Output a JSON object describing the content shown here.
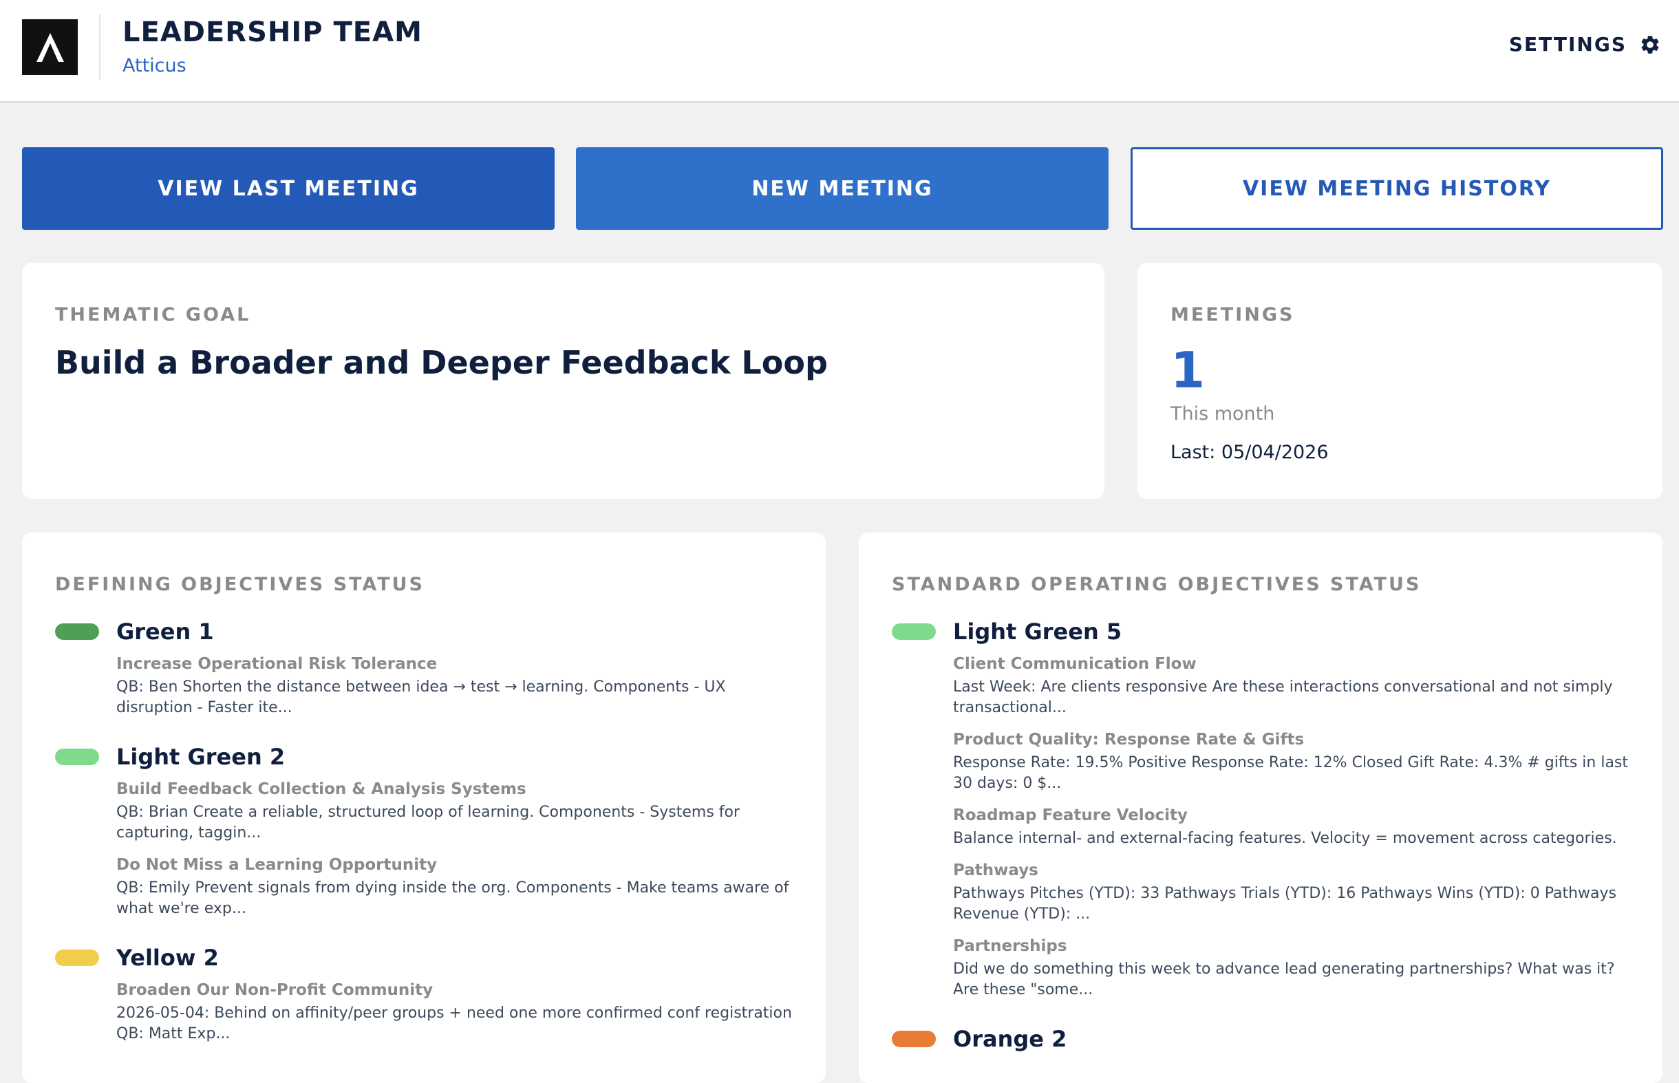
{
  "header": {
    "team_title": "LEADERSHIP TEAM",
    "team_subtitle": "Atticus",
    "settings_label": "SETTINGS",
    "logo_icon": "atticus-logo-icon",
    "settings_icon": "gear-icon"
  },
  "actions": {
    "view_last": "VIEW LAST MEETING",
    "new_meeting": "NEW MEETING",
    "view_history": "VIEW MEETING HISTORY"
  },
  "thematic_goal": {
    "label": "THEMATIC GOAL",
    "text": "Build a Broader and Deeper Feedback Loop"
  },
  "meetings": {
    "label": "MEETINGS",
    "count": "1",
    "period": "This month",
    "last": "Last: 05/04/2026"
  },
  "colors": {
    "green": "#4f9f55",
    "light_green": "#7ddb8b",
    "yellow": "#f2cd4a",
    "orange": "#e87c35",
    "primary": "#2359b7",
    "accent": "#2f70cb"
  },
  "defining": {
    "label": "DEFINING OBJECTIVES STATUS",
    "groups": [
      {
        "title": "Green 1",
        "color": "#4f9f55",
        "items": [
          {
            "title": "Increase Operational Risk Tolerance",
            "desc": "QB: Ben Shorten the distance between idea → test → learning. Components - UX disruption - Faster ite..."
          }
        ]
      },
      {
        "title": "Light Green 2",
        "color": "#7ddb8b",
        "items": [
          {
            "title": "Build Feedback Collection & Analysis Systems",
            "desc": "QB: Brian Create a reliable, structured loop of learning. Components - Systems for capturing, taggin..."
          },
          {
            "title": "Do Not Miss a Learning Opportunity",
            "desc": "QB: Emily Prevent signals from dying inside the org. Components - Make teams aware of what we're exp..."
          }
        ]
      },
      {
        "title": "Yellow 2",
        "color": "#f2cd4a",
        "items": [
          {
            "title": "Broaden Our Non-Profit Community",
            "desc": "2026-05-04: Behind on affinity/peer groups + need one more confirmed conf registration QB: Matt Exp..."
          }
        ]
      }
    ]
  },
  "standard": {
    "label": "STANDARD OPERATING OBJECTIVES STATUS",
    "groups": [
      {
        "title": "Light Green 5",
        "color": "#7ddb8b",
        "items": [
          {
            "title": "Client Communication Flow",
            "desc": "Last Week: Are clients responsive Are these interactions conversational and not simply transactional..."
          },
          {
            "title": "Product Quality: Response Rate & Gifts",
            "desc": "Response Rate: 19.5% Positive Response Rate: 12% Closed Gift Rate: 4.3% # gifts in last 30 days: 0 $..."
          },
          {
            "title": "Roadmap Feature Velocity",
            "desc": "Balance internal- and external-facing features. Velocity = movement across categories."
          },
          {
            "title": "Pathways",
            "desc": "Pathways Pitches (YTD): 33 Pathways Trials (YTD): 16 Pathways Wins (YTD): 0 Pathways Revenue (YTD): ..."
          },
          {
            "title": "Partnerships",
            "desc": "Did we do something this week to advance lead generating partnerships? What was it? Are these \"some..."
          }
        ]
      },
      {
        "title": "Orange 2",
        "color": "#e87c35",
        "items": []
      }
    ]
  }
}
